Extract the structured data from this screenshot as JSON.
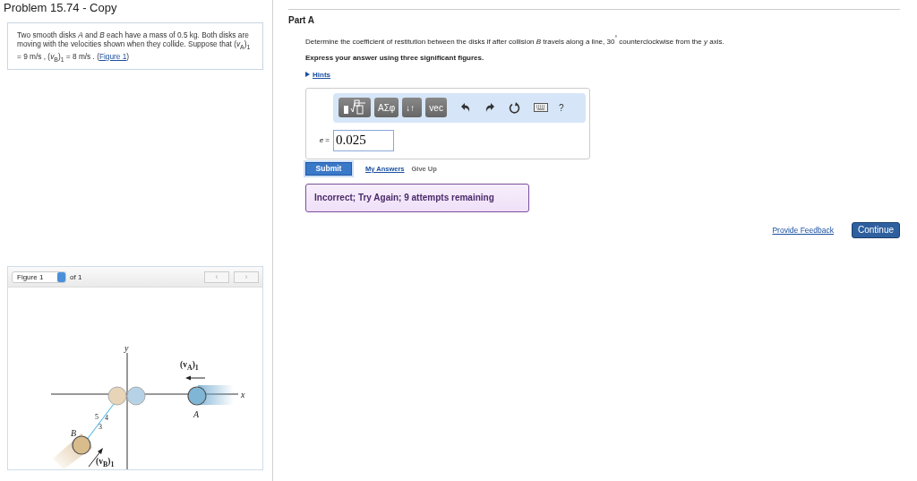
{
  "title": "Problem 15.74 - Copy",
  "problem": {
    "text": "Two smooth disks *A* and *B* each have a mass of 0.5 kg. Both disks are moving with the velocities shown when they collide. Suppose that (*v*$_{A}$)$_{1}$ = 9 m/s , (*v*$_{B}$)$_{1}$ = 8 m/s . (",
    "link": "Figure 1",
    "text_after": ")"
  },
  "figure": {
    "selector": "Figure 1",
    "of": "of 1",
    "prev": "‹",
    "next": "›",
    "labels": {
      "y": "y",
      "x": "x",
      "a": "A",
      "b": "B",
      "va": "(v$_{A}$)$_{1}$",
      "vb": "(v$_{B}$)$_{1}$",
      "s5": "5",
      "s4": "4",
      "s3": "3"
    }
  },
  "part": {
    "title": "Part A",
    "question": "Determine the coefficient of restitution between the disks if after collision *B* travels along a line, 30$^{°}$ counterclockwise from the *y* axis.",
    "instruction": "Express your answer using three significant figures.",
    "hints": "Hints"
  },
  "toolbar": [
    {
      "kind": "template"
    },
    {
      "kind": "text",
      "label": "ΑΣφ"
    },
    {
      "kind": "text",
      "label": "↓↑"
    },
    {
      "kind": "text",
      "label": "vec"
    },
    {
      "kind": "undo"
    },
    {
      "kind": "redo"
    },
    {
      "kind": "reset"
    },
    {
      "kind": "keyboard"
    },
    {
      "kind": "plain",
      "label": "?"
    }
  ],
  "answer": {
    "label": "*e* =",
    "value": "0.025"
  },
  "actions": {
    "submit": "Submit",
    "my_answers": "My Answers",
    "give_up": "Give Up"
  },
  "feedback": "Incorrect; Try Again; 9 attempts remaining",
  "footer": {
    "provide_feedback": "Provide Feedback",
    "continue": "Continue"
  }
}
